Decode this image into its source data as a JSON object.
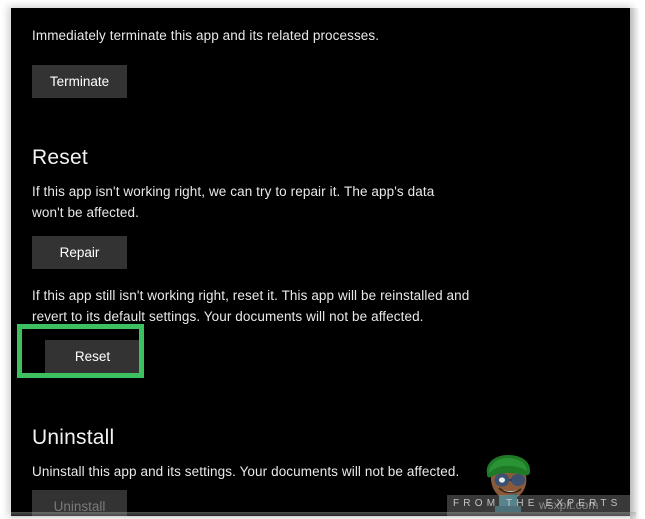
{
  "panel": {
    "background_color": "#000000",
    "text_color": "#e9e9e9",
    "button_color": "#333333"
  },
  "terminate_section": {
    "description": "Immediately terminate this app and its related processes.",
    "button_label": "Terminate"
  },
  "reset_section": {
    "heading": "Reset",
    "repair_description": "If this app isn't working right, we can try to repair it. The app's data won't be affected.",
    "repair_button_label": "Repair",
    "reset_description": "If this app still isn't working right, reset it. This app will be reinstalled and revert to its default settings. Your documents will not be affected.",
    "reset_button_label": "Reset"
  },
  "uninstall_section": {
    "heading": "Uninstall",
    "description": "Uninstall this app and its settings. Your documents will not be affected.",
    "button_label": "Uninstall"
  },
  "annotation": {
    "highlight_color": "#3dc060",
    "highlights": "reset-button"
  },
  "watermark": {
    "tagline": "FROM THE EXPERTS",
    "site": "wsxplt.com"
  }
}
